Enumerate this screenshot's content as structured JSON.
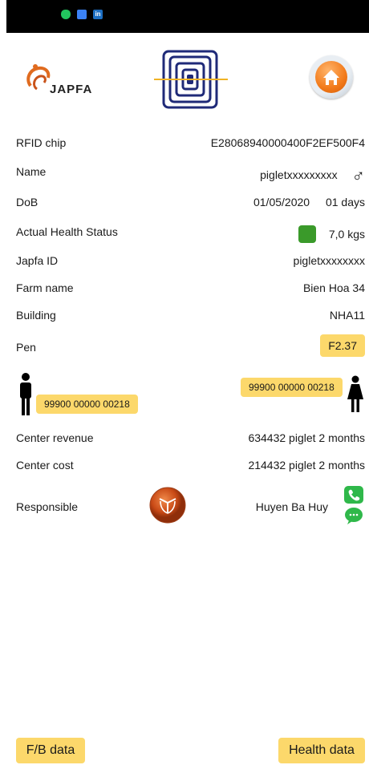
{
  "header": {
    "logo_text": "JAPFA"
  },
  "fields": {
    "rfid": {
      "label": "RFID chip",
      "value": "E28068940000400F2EF500F4"
    },
    "name": {
      "label": "Name",
      "value": "pigletxxxxxxxxx",
      "gender_icon": "male-symbol-icon",
      "gender_glyph": "♂"
    },
    "dob": {
      "label": "DoB",
      "value": "01/05/2020",
      "age": "01 days"
    },
    "health": {
      "label": "Actual Health Status",
      "status_color": "#3a9a2a",
      "weight": "7,0 kgs"
    },
    "japfa_id": {
      "label": "Japfa ID",
      "value": "pigletxxxxxxxx"
    },
    "farm": {
      "label": "Farm name",
      "value": "Bien Hoa 34"
    },
    "building": {
      "label": "Building",
      "value": "NHA11"
    },
    "pen": {
      "label": "Pen",
      "value": "F2.37"
    }
  },
  "parents": {
    "male_id": "99900 00000 00218",
    "female_id": "99900 00000 00218"
  },
  "finance": {
    "revenue": {
      "label": "Center revenue",
      "value": "634432 piglet 2 months"
    },
    "cost": {
      "label": "Center cost",
      "value": "214432 piglet 2 months"
    }
  },
  "responsible": {
    "label": "Responsible",
    "name": "Huyen Ba Huy"
  },
  "buttons": {
    "fb_data": "F/B data",
    "health_data": "Health data"
  },
  "colors": {
    "accent_yellow": "#fcd86b",
    "status_bar": "#000000",
    "health_ok": "#3a9a2a"
  }
}
